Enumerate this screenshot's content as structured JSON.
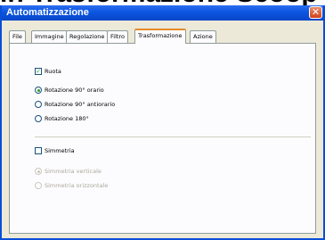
{
  "background_title": "in Trasformazione Scoop",
  "window": {
    "title": "Automatizzazione",
    "close_glyph": "✕"
  },
  "tabs": [
    {
      "label": "File",
      "active": false
    },
    {
      "label": "Immagine",
      "active": false
    },
    {
      "label": "Regolazione",
      "active": false
    },
    {
      "label": "Filtro",
      "active": false
    },
    {
      "label": "Trasformazione",
      "active": true
    },
    {
      "label": "Azione",
      "active": false
    }
  ],
  "rotate": {
    "checkbox_label": "Ruota",
    "checked": true,
    "options": [
      {
        "label": "Rotazione 90° orario",
        "selected": true
      },
      {
        "label": "Rotazione 90° antiorario",
        "selected": false
      },
      {
        "label": "Rotazione 180°",
        "selected": false
      }
    ]
  },
  "mirror": {
    "checkbox_label": "Simmetria",
    "checked": false,
    "options": [
      {
        "label": "Simmetria verticale",
        "selected": true
      },
      {
        "label": "Simmetria orizzontale",
        "selected": false
      }
    ]
  },
  "colors": {
    "accent_tab": "#e68b2c",
    "titlebar": "#0b55e0",
    "check": "#21a121"
  }
}
